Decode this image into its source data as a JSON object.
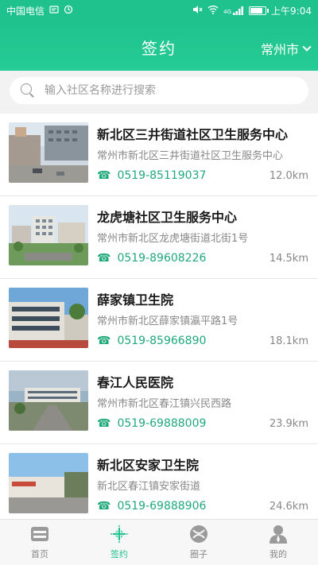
{
  "status_bar": {
    "carrier": "中国电信",
    "signal_text": "4G",
    "time": "上午9:04",
    "battery_level": 0.85
  },
  "header": {
    "title": "签约",
    "city": "常州市"
  },
  "search": {
    "placeholder": "输入社区名称进行搜索",
    "value": ""
  },
  "items": [
    {
      "name": "新北区三井街道社区卫生服务中心",
      "address": "常州市新北区三井街道社区卫生服务中心",
      "phone": "0519-85119037",
      "distance": "12.0km"
    },
    {
      "name": "龙虎塘社区卫生服务中心",
      "address": "常州市新北区龙虎塘街道北街1号",
      "phone": "0519-89608226",
      "distance": "14.5km"
    },
    {
      "name": "薛家镇卫生院",
      "address": "常州市新北区薛家镇瀛平路1号",
      "phone": "0519-85966890",
      "distance": "18.1km"
    },
    {
      "name": "春江人民医院",
      "address": "常州市新北区春江镇兴民西路",
      "phone": "0519-69888009",
      "distance": "23.9km"
    },
    {
      "name": "新北区安家卫生院",
      "address": "新北区春江镇安家街道",
      "phone": "0519-69888906",
      "distance": "24.6km"
    }
  ],
  "tabbar": [
    {
      "label": "首页",
      "icon": "home-icon",
      "active": false
    },
    {
      "label": "签约",
      "icon": "sign-icon",
      "active": true
    },
    {
      "label": "圈子",
      "icon": "circle-icon",
      "active": false
    },
    {
      "label": "我的",
      "icon": "profile-icon",
      "active": false
    }
  ],
  "colors": {
    "brand": "#1fc28c",
    "phone_text": "#1fa979"
  }
}
